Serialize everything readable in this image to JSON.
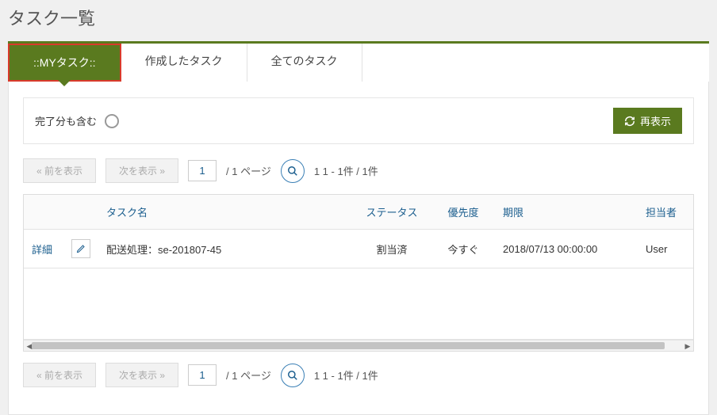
{
  "page_title": "タスク一覧",
  "tabs": {
    "my": "::MYタスク::",
    "created": "作成したタスク",
    "all": "全てのタスク"
  },
  "filter": {
    "include_completed_label": "完了分も含む",
    "refresh_label": "再表示"
  },
  "pager": {
    "prev_label": "«  前を表示",
    "next_label": "次を表示  »",
    "current_page": "1",
    "total_pages_label": "/  1 ページ",
    "count_summary": "1    1 - 1件 / 1件"
  },
  "table": {
    "headers": {
      "task_name": "タスク名",
      "status": "ステータス",
      "priority": "優先度",
      "due": "期限",
      "assignee": "担当者"
    },
    "detail_label": "詳細",
    "rows": [
      {
        "task_name": "配送処理：se-201807-45",
        "status": "割当済",
        "priority": "今すぐ",
        "due": "2018/07/13 00:00:00",
        "assignee": "User"
      }
    ]
  }
}
